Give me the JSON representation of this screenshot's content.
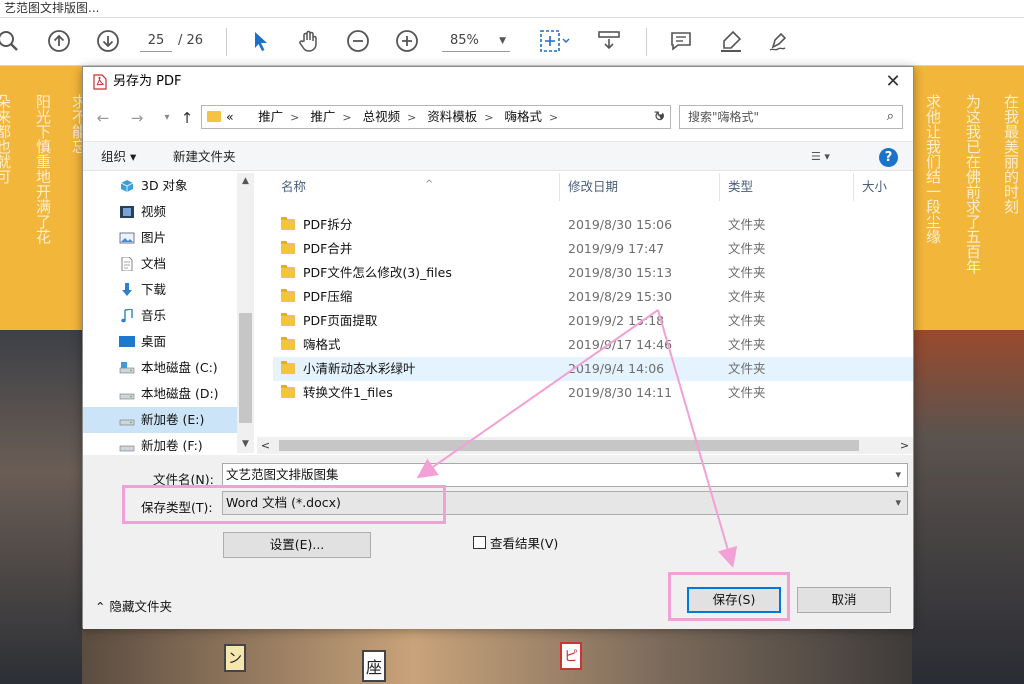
{
  "app": {
    "title": "艺范图文排版图..."
  },
  "toolbar": {
    "page_current": "25",
    "page_total": "/ 26",
    "zoom": "85%"
  },
  "poster": {
    "left_text": [
      "朵来都也就可",
      "阳光下慎重地开满了花",
      "求不能忘"
    ],
    "right_text": [
      "求他让我们结一段尘缘",
      "为这我已在佛前求了五百年",
      "在我最美丽的时刻"
    ],
    "signs": [
      "座",
      "ピ",
      "ン"
    ]
  },
  "dialog": {
    "title": "另存为 PDF",
    "close": "✕",
    "nav": {
      "back": "←",
      "forward": "→",
      "up": "↑"
    },
    "address": {
      "prefix": "«",
      "crumbs": [
        "推广",
        "推广",
        "总视频",
        "资料模板",
        "嗨格式"
      ],
      "search_placeholder": "搜索\"嗨格式\""
    },
    "commands": {
      "organize": "组织 ▾",
      "new_folder": "新建文件夹",
      "help": "?"
    },
    "tree": [
      {
        "label": "3D 对象",
        "icon": "cube-icon"
      },
      {
        "label": "视频",
        "icon": "film-icon"
      },
      {
        "label": "图片",
        "icon": "picture-icon"
      },
      {
        "label": "文档",
        "icon": "document-icon"
      },
      {
        "label": "下载",
        "icon": "download-icon"
      },
      {
        "label": "音乐",
        "icon": "music-icon"
      },
      {
        "label": "桌面",
        "icon": "desktop-icon"
      },
      {
        "label": "本地磁盘 (C:)",
        "icon": "drive-icon"
      },
      {
        "label": "本地磁盘 (D:)",
        "icon": "drive-icon"
      },
      {
        "label": "新加卷 (E:)",
        "icon": "drive-icon"
      },
      {
        "label": "新加卷 (F:)",
        "icon": "drive-icon"
      }
    ],
    "columns": {
      "name": "名称",
      "date": "修改日期",
      "type": "类型",
      "size": "大小"
    },
    "files": [
      {
        "name": "PDF拆分",
        "date": "2019/8/30 15:06",
        "type": "文件夹"
      },
      {
        "name": "PDF合并",
        "date": "2019/9/9 17:47",
        "type": "文件夹"
      },
      {
        "name": "PDF文件怎么修改(3)_files",
        "date": "2019/8/30 15:13",
        "type": "文件夹"
      },
      {
        "name": "PDF压缩",
        "date": "2019/8/29 15:30",
        "type": "文件夹"
      },
      {
        "name": "PDF页面提取",
        "date": "2019/9/2 15:18",
        "type": "文件夹"
      },
      {
        "name": "嗨格式",
        "date": "2019/9/17 14:46",
        "type": "文件夹"
      },
      {
        "name": "小清新动态水彩绿叶",
        "date": "2019/9/4 14:06",
        "type": "文件夹"
      },
      {
        "name": "转换文件1_files",
        "date": "2019/8/30 14:11",
        "type": "文件夹"
      }
    ],
    "form": {
      "filename_label": "文件名(N):",
      "filename_value": "文艺范图文排版图集",
      "type_label": "保存类型(T):",
      "type_value": "Word 文档 (*.docx)",
      "settings_button": "设置(E)...",
      "view_result_label": "查看结果(V)",
      "hide_folders": "隐藏文件夹",
      "save_button": "保存(S)",
      "cancel_button": "取消"
    }
  },
  "colors": {
    "annotation": "#f2a0d6",
    "accent": "#0078d7",
    "selection": "#cce4f7",
    "poster_yellow": "#f2b63b"
  }
}
